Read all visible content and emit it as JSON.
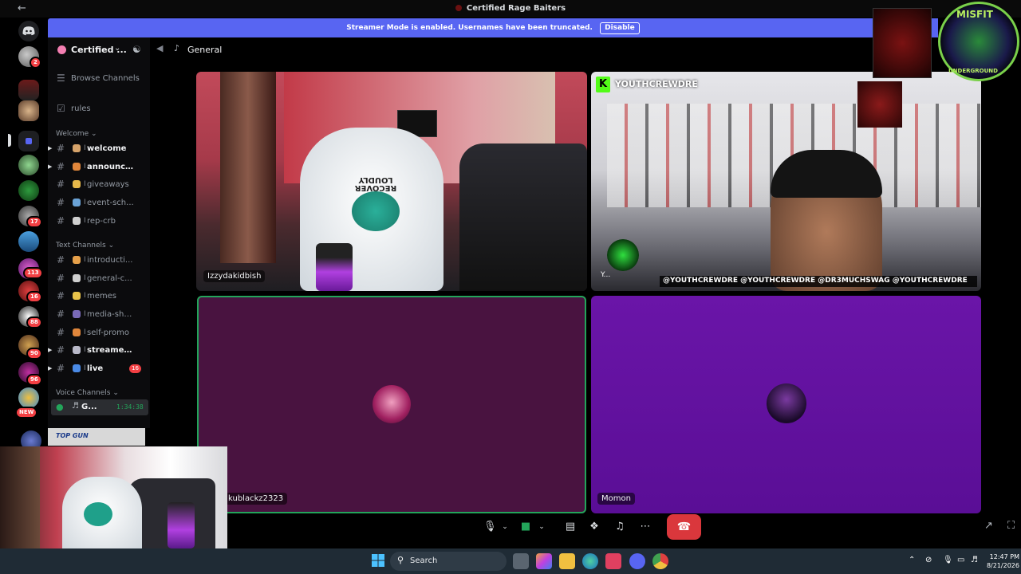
{
  "window": {
    "title": "Certified Rage Baiters"
  },
  "banner": {
    "text": "Streamer Mode is enabled. Usernames have been truncated.",
    "button": "Disable"
  },
  "rail": {
    "badges": [
      "2",
      "17",
      "113",
      "16",
      "88",
      "90",
      "96"
    ],
    "new_label": "NEW"
  },
  "sidebar": {
    "server_name": "Certified ...",
    "browse": "Browse Channels",
    "rules": "rules",
    "categories": {
      "welcome": "Welcome",
      "text": "Text Channels",
      "voice": "Voice Channels"
    },
    "channels": [
      {
        "label": "welcome",
        "unread": true,
        "arrow": true,
        "color": "#d6a36a"
      },
      {
        "label": "announce...",
        "unread": true,
        "arrow": true,
        "color": "#e0863b"
      },
      {
        "label": "giveaways",
        "unread": false,
        "arrow": false,
        "color": "#e6b84a"
      },
      {
        "label": "event-sch...",
        "unread": false,
        "arrow": false,
        "color": "#6aa2d6"
      },
      {
        "label": "rep-crb",
        "unread": false,
        "arrow": false,
        "color": "#cfcfcf"
      },
      {
        "label": "introducti...",
        "unread": false,
        "arrow": false,
        "color": "#e6a04a"
      },
      {
        "label": "general-c...",
        "unread": false,
        "arrow": false,
        "color": "#cfcfcf"
      },
      {
        "label": "memes",
        "unread": false,
        "arrow": false,
        "color": "#e9c34a"
      },
      {
        "label": "media-sha...",
        "unread": false,
        "arrow": false,
        "color": "#7a6ab8"
      },
      {
        "label": "self-promo",
        "unread": false,
        "arrow": false,
        "color": "#e0863b"
      },
      {
        "label": "streamer-...",
        "unread": true,
        "arrow": true,
        "color": "#b8b8c8"
      },
      {
        "label": "live",
        "unread": true,
        "arrow": true,
        "color": "#4a8ae6",
        "count": "16"
      }
    ],
    "voice_channel": {
      "label": "G...",
      "timer": "1:34:38"
    }
  },
  "voice_header": {
    "channel": "General"
  },
  "tiles": {
    "top_left": {
      "name": "Izzydakidbish"
    },
    "top_right": {
      "brand": "YOUTHCREWDRE",
      "handles": "@YOUTHCREWDRE @YOUTHCREWDRE @DR3MUCHSWAG @YOUTHCREWDRE",
      "name_initial": "Y..."
    },
    "bottom_left": {
      "name": "kublackz2323"
    },
    "bottom_right": {
      "name": "Momon"
    }
  },
  "overlays": {
    "misfit": {
      "line1": "MISFIT",
      "line2": "UNDERGROUND"
    },
    "shirt_text": "RECOVER LOUDLY",
    "topgun": "TOP GUN"
  },
  "taskbar": {
    "search": "Search",
    "time": "12:47 PM",
    "date": "8/21/2026"
  }
}
